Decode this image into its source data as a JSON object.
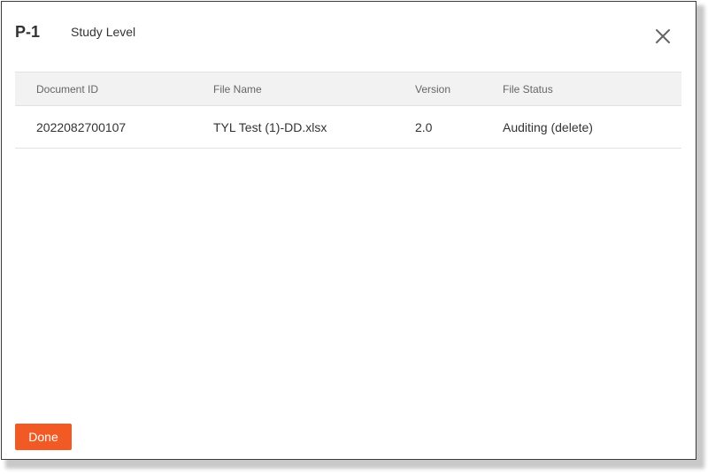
{
  "dialog": {
    "code": "P-1",
    "level": "Study Level",
    "close_icon": "close-icon"
  },
  "table": {
    "columns": [
      "Document ID",
      "File Name",
      "Version",
      "File Status"
    ],
    "rows": [
      {
        "document_id": "2022082700107",
        "file_name": "TYL Test (1)-DD.xlsx",
        "version": "2.0",
        "file_status": "Auditing (delete)"
      }
    ]
  },
  "footer": {
    "done_label": "Done"
  },
  "colors": {
    "accent": "#f15a24",
    "header_bg": "#f2f2f2",
    "border": "#e2e2e2",
    "text": "#333333"
  }
}
